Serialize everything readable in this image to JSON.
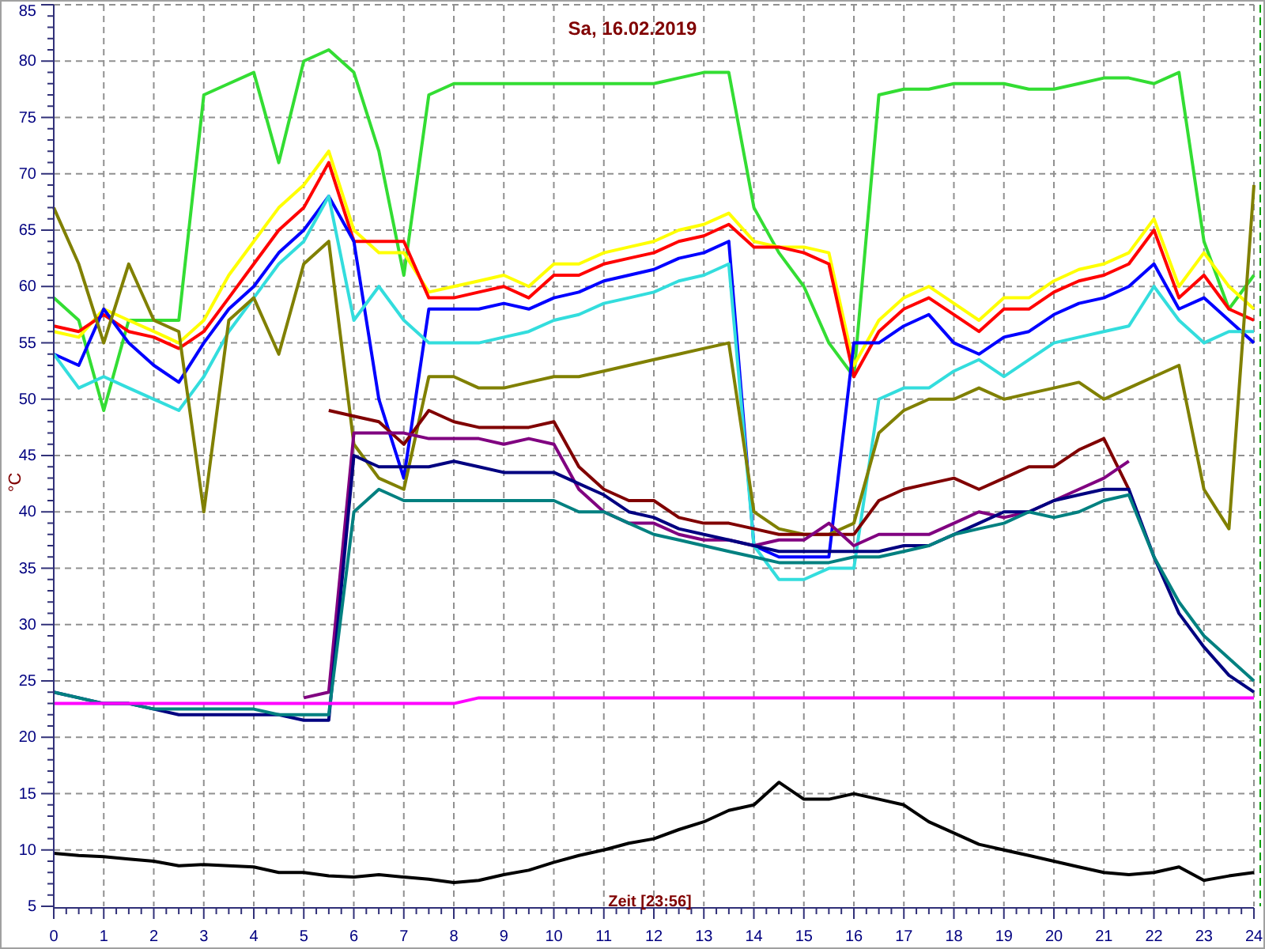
{
  "chart": {
    "chart_data": {
      "type": "line",
      "title": "Sa, 16.02.2019",
      "xlabel": "Zeit [23:56]",
      "ylabel": "°C",
      "x": [
        0,
        0.5,
        1,
        1.5,
        2,
        2.5,
        3,
        3.5,
        4,
        4.5,
        5,
        5.5,
        6,
        6.5,
        7,
        7.5,
        8,
        8.5,
        9,
        9.5,
        10,
        10.5,
        11,
        11.5,
        12,
        12.5,
        13,
        13.5,
        14,
        14.5,
        15,
        15.5,
        16,
        16.5,
        17,
        17.5,
        18,
        18.5,
        19,
        19.5,
        20,
        20.5,
        21,
        21.5,
        22,
        22.5,
        23,
        23.5,
        24
      ],
      "xlim": [
        0,
        24
      ],
      "ylim": [
        5,
        85
      ],
      "grid": true,
      "xticks": [
        0,
        1,
        2,
        3,
        4,
        5,
        6,
        7,
        8,
        9,
        10,
        11,
        12,
        13,
        14,
        15,
        16,
        17,
        18,
        19,
        20,
        21,
        22,
        23,
        24
      ],
      "yticks": [
        5,
        10,
        15,
        20,
        25,
        30,
        35,
        40,
        45,
        50,
        55,
        60,
        65,
        70,
        75,
        80,
        85
      ],
      "series": [
        {
          "color": "#33dd33",
          "values": [
            59,
            57,
            49,
            57,
            57,
            57,
            77,
            78,
            79,
            71,
            80,
            81,
            79,
            72,
            61,
            77,
            78,
            78,
            78,
            78,
            78,
            78,
            78,
            78,
            78,
            78.5,
            79,
            79,
            67,
            63,
            60,
            55,
            52,
            77,
            77.5,
            77.5,
            78,
            78,
            78,
            77.5,
            77.5,
            78,
            78.5,
            78.5,
            78,
            79,
            64,
            58,
            61
          ]
        },
        {
          "color": "#ffff00",
          "values": [
            56,
            55.5,
            58,
            57,
            56,
            55,
            57,
            61,
            64,
            67,
            69,
            72,
            65,
            63,
            63,
            59.5,
            60,
            60.5,
            61,
            60,
            62,
            62,
            63,
            63.5,
            64,
            65,
            65.5,
            66.5,
            64,
            63.5,
            63.5,
            63,
            53,
            57,
            59,
            60,
            58.5,
            57,
            59,
            59,
            60.5,
            61.5,
            62,
            63,
            66,
            60,
            63,
            60,
            58
          ]
        },
        {
          "color": "#ff0000",
          "values": [
            56.5,
            56,
            57.5,
            56,
            55.5,
            54.5,
            56,
            59,
            62,
            65,
            67,
            71,
            64,
            64,
            64,
            59,
            59,
            59.5,
            60,
            59,
            61,
            61,
            62,
            62.5,
            63,
            64,
            64.5,
            65.5,
            63.5,
            63.5,
            63,
            62,
            52,
            56,
            58,
            59,
            57.5,
            56,
            58,
            58,
            59.5,
            60.5,
            61,
            62,
            65,
            59,
            61,
            58,
            57
          ]
        },
        {
          "color": "#0000ff",
          "values": [
            54,
            53,
            58,
            55,
            53,
            51.5,
            55,
            58,
            60,
            63,
            65,
            68,
            64,
            50,
            43,
            58,
            58,
            58,
            58.5,
            58,
            59,
            59.5,
            60.5,
            61,
            61.5,
            62.5,
            63,
            64,
            37,
            36,
            36,
            36,
            55,
            55,
            56.5,
            57.5,
            55,
            54,
            55.5,
            56,
            57.5,
            58.5,
            59,
            60,
            62,
            58,
            59,
            57,
            55
          ]
        },
        {
          "color": "#33dddd",
          "values": [
            54,
            51,
            52,
            51,
            50,
            49,
            52,
            56,
            59,
            62,
            64,
            68,
            57,
            60,
            57,
            55,
            55,
            55,
            55.5,
            56,
            57,
            57.5,
            58.5,
            59,
            59.5,
            60.5,
            61,
            62,
            37,
            34,
            34,
            35,
            35,
            50,
            51,
            51,
            52.5,
            53.5,
            52,
            53.5,
            55,
            55.5,
            56,
            56.5,
            60,
            57,
            55,
            56,
            56
          ]
        },
        {
          "color": "#808000",
          "values": [
            67,
            62,
            55,
            62,
            57,
            56,
            40,
            57,
            59,
            54,
            62,
            64,
            46,
            43,
            42,
            52,
            52,
            51,
            51,
            51.5,
            52,
            52,
            52.5,
            53,
            53.5,
            54,
            54.5,
            55,
            40,
            38.5,
            38,
            38,
            39,
            47,
            49,
            50,
            50,
            51,
            50,
            50.5,
            51,
            51.5,
            50,
            51,
            52,
            53,
            42,
            38.5,
            69
          ]
        },
        {
          "color": "#800000",
          "values": [
            null,
            null,
            null,
            null,
            null,
            null,
            null,
            null,
            null,
            null,
            null,
            49,
            48.5,
            48,
            46,
            49,
            48,
            47.5,
            47.5,
            47.5,
            48,
            44,
            42,
            41,
            41,
            39.5,
            39,
            39,
            38.5,
            38,
            38,
            38,
            38,
            41,
            42,
            42.5,
            43,
            42,
            43,
            44,
            44,
            45.5,
            46.5,
            42,
            null,
            null,
            null,
            null,
            null
          ]
        },
        {
          "color": "#800080",
          "values": [
            null,
            null,
            null,
            null,
            null,
            null,
            null,
            null,
            null,
            null,
            23.5,
            24,
            47,
            47,
            47,
            46.5,
            46.5,
            46.5,
            46,
            46.5,
            46,
            42,
            40,
            39,
            39,
            38,
            37.5,
            37.5,
            37,
            37.5,
            37.5,
            39,
            37,
            38,
            38,
            38,
            39,
            40,
            39.5,
            40,
            41,
            42,
            43,
            44.5,
            null,
            null,
            null,
            null,
            null
          ]
        },
        {
          "color": "#000080",
          "values": [
            24,
            23.5,
            23,
            23,
            22.5,
            22,
            22,
            22,
            22,
            22,
            21.5,
            21.5,
            45,
            44,
            44,
            44,
            44.5,
            44,
            43.5,
            43.5,
            43.5,
            42.5,
            41.5,
            40,
            39.5,
            38.5,
            38,
            37.5,
            37,
            36.5,
            36.5,
            36.5,
            36.5,
            36.5,
            37,
            37,
            38,
            39,
            40,
            40,
            41,
            41.5,
            42,
            42,
            36,
            31,
            28,
            25.5,
            24
          ]
        },
        {
          "color": "#008080",
          "values": [
            24,
            23.5,
            23,
            23,
            22.5,
            22.5,
            22.5,
            22.5,
            22.5,
            22,
            22,
            22,
            40,
            42,
            41,
            41,
            41,
            41,
            41,
            41,
            41,
            40,
            40,
            39,
            38,
            37.5,
            37,
            36.5,
            36,
            35.5,
            35.5,
            35.5,
            36,
            36,
            36.5,
            37,
            38,
            38.5,
            39,
            40,
            39.5,
            40,
            41,
            41.5,
            36,
            32,
            29,
            27,
            25
          ]
        },
        {
          "color": "#ff00ff",
          "values": [
            23,
            23,
            23,
            23,
            23,
            23,
            23,
            23,
            23,
            23,
            23,
            23,
            23,
            23,
            23,
            23,
            23,
            23.5,
            23.5,
            23.5,
            23.5,
            23.5,
            23.5,
            23.5,
            23.5,
            23.5,
            23.5,
            23.5,
            23.5,
            23.5,
            23.5,
            23.5,
            23.5,
            23.5,
            23.5,
            23.5,
            23.5,
            23.5,
            23.5,
            23.5,
            23.5,
            23.5,
            23.5,
            23.5,
            23.5,
            23.5,
            23.5,
            23.5,
            23.5
          ]
        },
        {
          "color": "#000000",
          "values": [
            9.7,
            9.5,
            9.4,
            9.2,
            9,
            8.6,
            8.7,
            8.6,
            8.5,
            8,
            8,
            7.7,
            7.6,
            7.8,
            7.6,
            7.4,
            7.1,
            7.3,
            7.8,
            8.2,
            8.9,
            9.5,
            10,
            10.6,
            11,
            11.8,
            12.5,
            13.5,
            14,
            16,
            14.5,
            14.5,
            15,
            14.5,
            14,
            12.5,
            11.5,
            10.5,
            10,
            9.5,
            9,
            8.5,
            8,
            7.8,
            8,
            8.5,
            7.3,
            7.7,
            8
          ]
        }
      ]
    }
  }
}
